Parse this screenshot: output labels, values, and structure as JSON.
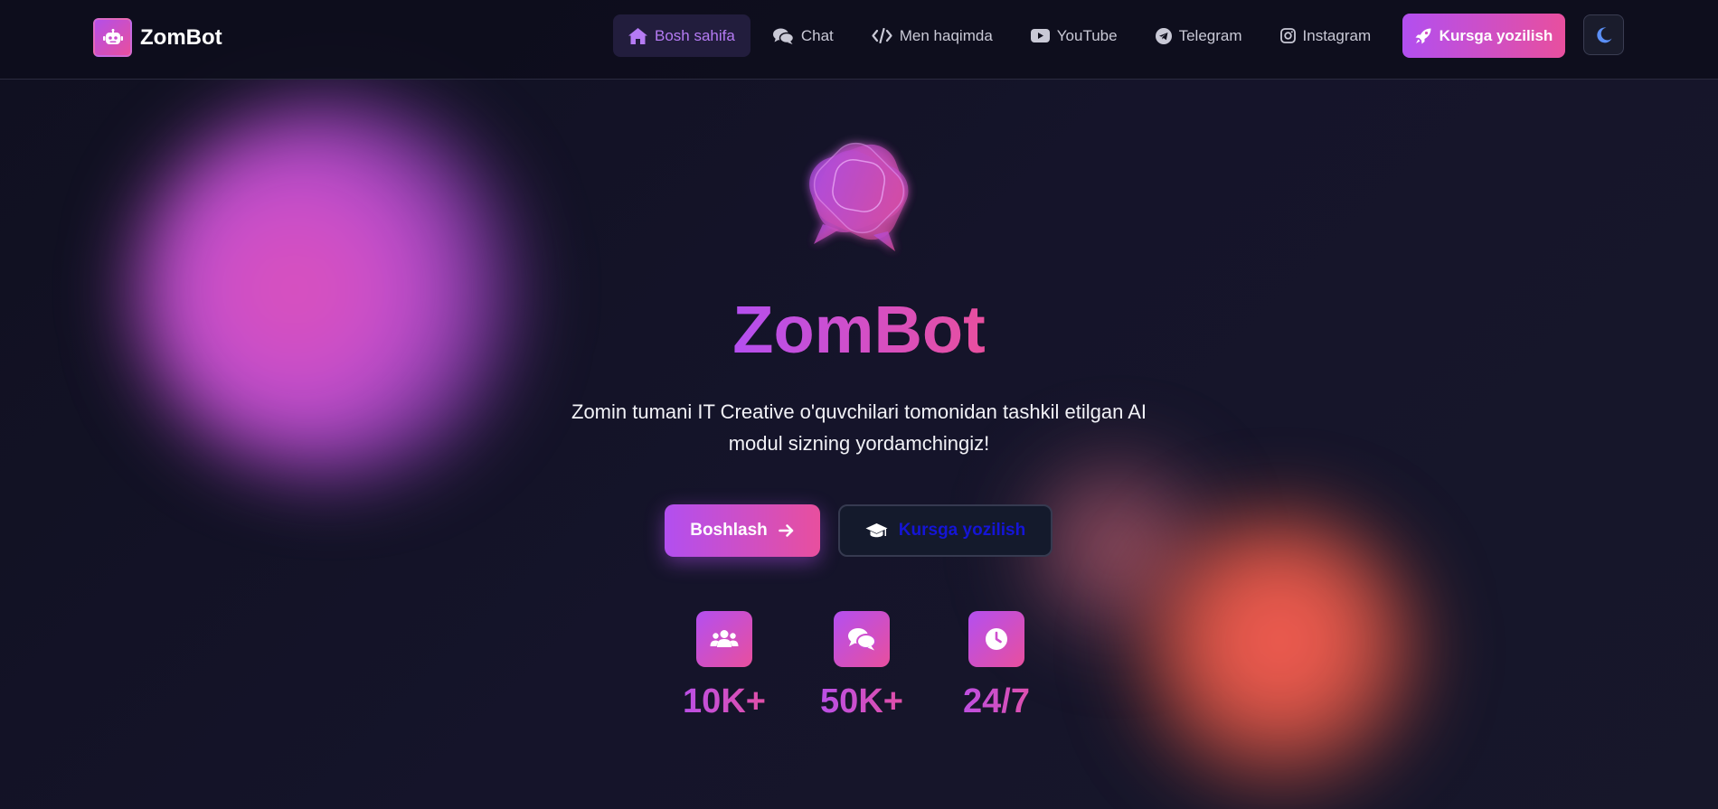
{
  "brand": {
    "name": "ZomBot",
    "logo_icon": "robot-icon"
  },
  "nav": {
    "links": [
      {
        "label": "Bosh sahifa",
        "icon": "home-icon",
        "active": true
      },
      {
        "label": "Chat",
        "icon": "comments-icon",
        "active": false
      },
      {
        "label": "Men haqimda",
        "icon": "code-icon",
        "active": false
      },
      {
        "label": "YouTube",
        "icon": "youtube-icon",
        "active": false
      },
      {
        "label": "Telegram",
        "icon": "telegram-icon",
        "active": false
      },
      {
        "label": "Instagram",
        "icon": "instagram-icon",
        "active": false
      }
    ],
    "enroll_label": "Kursga yozilish",
    "enroll_icon": "rocket-icon",
    "theme_toggle_icon": "moon-icon"
  },
  "hero": {
    "title": "ZomBot",
    "subtitle": "Zomin tumani IT Creative o'quvchilari tomonidan tashkil etilgan AI modul sizning yordamchingiz!",
    "primary_cta": "Boshlash",
    "secondary_cta": "Kursga yozilish"
  },
  "stats": [
    {
      "value": "10K+",
      "icon": "users-icon"
    },
    {
      "value": "50K+",
      "icon": "comments-icon"
    },
    {
      "value": "24/7",
      "icon": "clock-icon"
    }
  ],
  "colors": {
    "accent_purple": "#b44ff0",
    "accent_pink": "#e84f9e",
    "background": "#13131f",
    "active_nav_text": "#b57bf4",
    "secondary_cta_text": "#1515d6"
  }
}
